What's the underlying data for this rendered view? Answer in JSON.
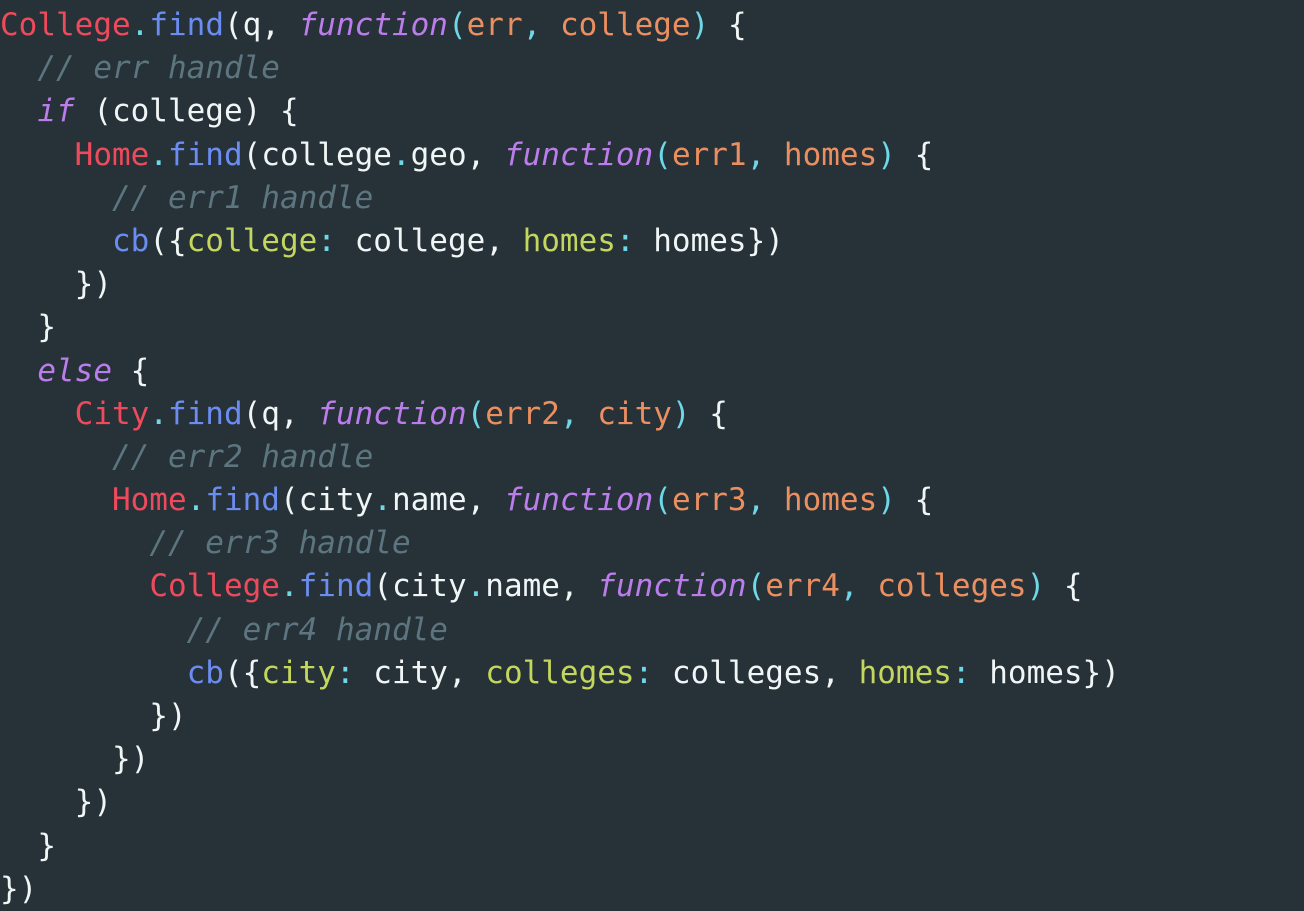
{
  "editor": {
    "language": "javascript",
    "background_color": "#263238",
    "font_size_px": 31,
    "line_height_px": 43.2,
    "total_lines": 21
  },
  "theme": {
    "class_color": "#ef4a5c",
    "method_color": "#6b8cf0",
    "punctuation_color": "#6fd8e8",
    "keyword_color": "#bc7dec",
    "parameter_color": "#ec8f60",
    "object_key_color": "#c4d65c",
    "plain_color": "#f0f5f5",
    "comment_color": "#5d757f"
  },
  "code": {
    "plain_text": "College.find(q, function(err, college) {\n  // err handle\n  if (college) {\n    Home.find(college.geo, function(err1, homes) {\n      // err1 handle\n      cb({college: college, homes: homes})\n    })\n  }\n  else {\n    City.find(q, function(err2, city) {\n      // err2 handle\n      Home.find(city.name, function(err3, homes) {\n        // err3 handle\n        College.find(city.name, function(err4, colleges) {\n          // err4 handle\n          cb({city: city, colleges: colleges, homes: homes})\n        })\n      })\n    })\n  }\n})",
    "lines": [
      {
        "n": 1,
        "indent": 0,
        "text": "College.find(q, function(err, college) {"
      },
      {
        "n": 2,
        "indent": 2,
        "text": "// err handle"
      },
      {
        "n": 3,
        "indent": 2,
        "text": "if (college) {"
      },
      {
        "n": 4,
        "indent": 4,
        "text": "Home.find(college.geo, function(err1, homes) {"
      },
      {
        "n": 5,
        "indent": 6,
        "text": "// err1 handle"
      },
      {
        "n": 6,
        "indent": 6,
        "text": "cb({college: college, homes: homes})"
      },
      {
        "n": 7,
        "indent": 4,
        "text": "})"
      },
      {
        "n": 8,
        "indent": 2,
        "text": "}"
      },
      {
        "n": 9,
        "indent": 2,
        "text": "else {"
      },
      {
        "n": 10,
        "indent": 4,
        "text": "City.find(q, function(err2, city) {"
      },
      {
        "n": 11,
        "indent": 6,
        "text": "// err2 handle"
      },
      {
        "n": 12,
        "indent": 6,
        "text": "Home.find(city.name, function(err3, homes) {"
      },
      {
        "n": 13,
        "indent": 8,
        "text": "// err3 handle"
      },
      {
        "n": 14,
        "indent": 8,
        "text": "College.find(city.name, function(err4, colleges) {"
      },
      {
        "n": 15,
        "indent": 10,
        "text": "// err4 handle"
      },
      {
        "n": 16,
        "indent": 10,
        "text": "cb({city: city, colleges: colleges, homes: homes})"
      },
      {
        "n": 17,
        "indent": 8,
        "text": "})"
      },
      {
        "n": 18,
        "indent": 6,
        "text": "})"
      },
      {
        "n": 19,
        "indent": 4,
        "text": "})"
      },
      {
        "n": 20,
        "indent": 2,
        "text": "}"
      },
      {
        "n": 21,
        "indent": 0,
        "text": "})"
      }
    ],
    "tokens": [
      [
        [
          "cls",
          "College"
        ],
        [
          "pun",
          "."
        ],
        [
          "mth",
          "find"
        ],
        [
          "pln",
          "(q, "
        ],
        [
          "kw",
          "function"
        ],
        [
          "pun",
          "("
        ],
        [
          "par",
          "err"
        ],
        [
          "pun",
          ", "
        ],
        [
          "par",
          "college"
        ],
        [
          "pun",
          ")"
        ],
        [
          "pln",
          " {"
        ]
      ],
      [
        [
          "pln",
          "  "
        ],
        [
          "cmt",
          "// err handle"
        ]
      ],
      [
        [
          "pln",
          "  "
        ],
        [
          "kw",
          "if"
        ],
        [
          "pln",
          " (college) {"
        ]
      ],
      [
        [
          "pln",
          "    "
        ],
        [
          "cls",
          "Home"
        ],
        [
          "pun",
          "."
        ],
        [
          "mth",
          "find"
        ],
        [
          "pln",
          "(college"
        ],
        [
          "pun",
          "."
        ],
        [
          "pln",
          "geo, "
        ],
        [
          "kw",
          "function"
        ],
        [
          "pun",
          "("
        ],
        [
          "par",
          "err1"
        ],
        [
          "pun",
          ", "
        ],
        [
          "par",
          "homes"
        ],
        [
          "pun",
          ")"
        ],
        [
          "pln",
          " {"
        ]
      ],
      [
        [
          "pln",
          "      "
        ],
        [
          "cmt",
          "// err1 handle"
        ]
      ],
      [
        [
          "pln",
          "      "
        ],
        [
          "mth",
          "cb"
        ],
        [
          "pln",
          "({"
        ],
        [
          "key",
          "college"
        ],
        [
          "pun",
          ":"
        ],
        [
          "pln",
          " college, "
        ],
        [
          "key",
          "homes"
        ],
        [
          "pun",
          ":"
        ],
        [
          "pln",
          " homes})"
        ]
      ],
      [
        [
          "pln",
          "    })"
        ]
      ],
      [
        [
          "pln",
          "  }"
        ]
      ],
      [
        [
          "pln",
          "  "
        ],
        [
          "kw",
          "else"
        ],
        [
          "pln",
          " {"
        ]
      ],
      [
        [
          "pln",
          "    "
        ],
        [
          "cls",
          "City"
        ],
        [
          "pun",
          "."
        ],
        [
          "mth",
          "find"
        ],
        [
          "pln",
          "(q, "
        ],
        [
          "kw",
          "function"
        ],
        [
          "pun",
          "("
        ],
        [
          "par",
          "err2"
        ],
        [
          "pun",
          ", "
        ],
        [
          "par",
          "city"
        ],
        [
          "pun",
          ")"
        ],
        [
          "pln",
          " {"
        ]
      ],
      [
        [
          "pln",
          "      "
        ],
        [
          "cmt",
          "// err2 handle"
        ]
      ],
      [
        [
          "pln",
          "      "
        ],
        [
          "cls",
          "Home"
        ],
        [
          "pun",
          "."
        ],
        [
          "mth",
          "find"
        ],
        [
          "pln",
          "(city"
        ],
        [
          "pun",
          "."
        ],
        [
          "pln",
          "name, "
        ],
        [
          "kw",
          "function"
        ],
        [
          "pun",
          "("
        ],
        [
          "par",
          "err3"
        ],
        [
          "pun",
          ", "
        ],
        [
          "par",
          "homes"
        ],
        [
          "pun",
          ")"
        ],
        [
          "pln",
          " {"
        ]
      ],
      [
        [
          "pln",
          "        "
        ],
        [
          "cmt",
          "// err3 handle"
        ]
      ],
      [
        [
          "pln",
          "        "
        ],
        [
          "cls",
          "College"
        ],
        [
          "pun",
          "."
        ],
        [
          "mth",
          "find"
        ],
        [
          "pln",
          "(city"
        ],
        [
          "pun",
          "."
        ],
        [
          "pln",
          "name, "
        ],
        [
          "kw",
          "function"
        ],
        [
          "pun",
          "("
        ],
        [
          "par",
          "err4"
        ],
        [
          "pun",
          ", "
        ],
        [
          "par",
          "colleges"
        ],
        [
          "pun",
          ")"
        ],
        [
          "pln",
          " {"
        ]
      ],
      [
        [
          "pln",
          "          "
        ],
        [
          "cmt",
          "// err4 handle"
        ]
      ],
      [
        [
          "pln",
          "          "
        ],
        [
          "mth",
          "cb"
        ],
        [
          "pln",
          "({"
        ],
        [
          "key",
          "city"
        ],
        [
          "pun",
          ":"
        ],
        [
          "pln",
          " city, "
        ],
        [
          "key",
          "colleges"
        ],
        [
          "pun",
          ":"
        ],
        [
          "pln",
          " colleges, "
        ],
        [
          "key",
          "homes"
        ],
        [
          "pun",
          ":"
        ],
        [
          "pln",
          " homes})"
        ]
      ],
      [
        [
          "pln",
          "        })"
        ]
      ],
      [
        [
          "pln",
          "      })"
        ]
      ],
      [
        [
          "pln",
          "    })"
        ]
      ],
      [
        [
          "pln",
          "  }"
        ]
      ],
      [
        [
          "pln",
          "})"
        ]
      ]
    ]
  }
}
